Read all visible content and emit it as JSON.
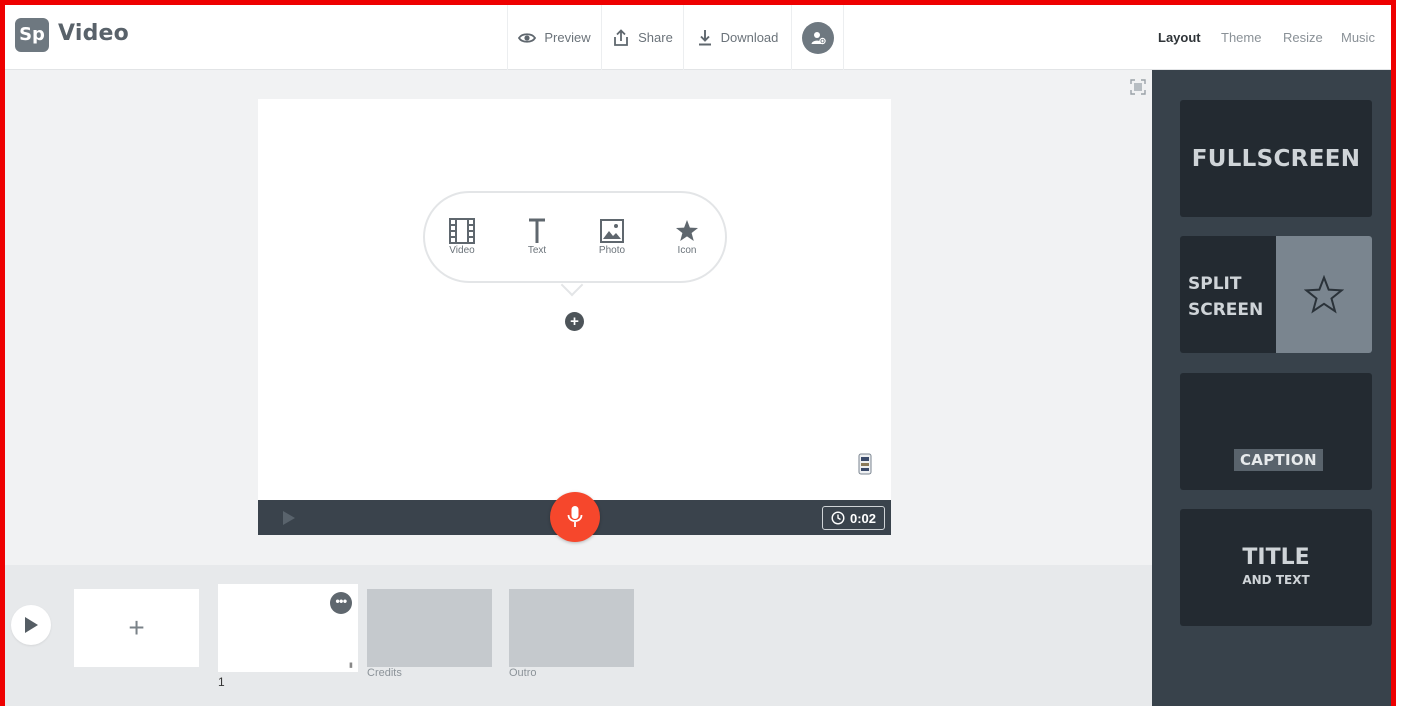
{
  "app": {
    "logo": "Sp",
    "title": "Video"
  },
  "toolbar": {
    "preview": "Preview",
    "share": "Share",
    "download": "Download"
  },
  "nav": {
    "layout": "Layout",
    "theme": "Theme",
    "resize": "Resize",
    "music": "Music",
    "active": "Layout"
  },
  "stage": {
    "tools": [
      {
        "label": "Video",
        "icon": "film-icon"
      },
      {
        "label": "Text",
        "icon": "text-icon"
      },
      {
        "label": "Photo",
        "icon": "photo-icon"
      },
      {
        "label": "Icon",
        "icon": "star-icon"
      }
    ],
    "add_symbol": "+",
    "timer": "0:02"
  },
  "timeline": {
    "add_symbol": "+",
    "slide_number": "1",
    "more_symbol": "•••",
    "slides": [
      {
        "label": "Credits"
      },
      {
        "label": "Outro"
      }
    ]
  },
  "layouts": {
    "fullscreen": "FULLSCREEN",
    "split_line1": "SPLIT",
    "split_line2": "SCREEN",
    "caption": "CAPTION",
    "title": "TITLE",
    "title_sub": "AND TEXT"
  },
  "colors": {
    "accent": "#f6472c",
    "panel": "#38424b",
    "card": "#232a31"
  }
}
